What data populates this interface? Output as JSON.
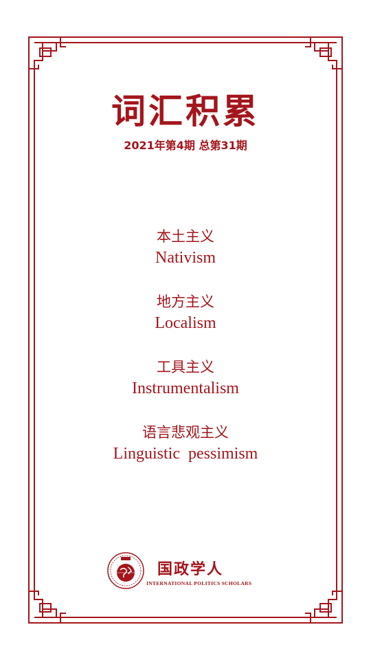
{
  "header": {
    "title": "词汇积累",
    "issue": "2021年第4期 总第31期"
  },
  "terms": [
    {
      "zh": "本土主义",
      "en": "Nativism"
    },
    {
      "zh": "地方主义",
      "en": "Localism"
    },
    {
      "zh": "工具主义",
      "en": "Instrumentalism"
    },
    {
      "zh": "语言悲观主义",
      "en": "Linguistic  pessimism"
    }
  ],
  "footer": {
    "brand_name": "国政学人",
    "brand_subtitle": "INTERNATIONAL POLITICS SCHOLARS",
    "logo_icon": "globe-seal-icon"
  },
  "colors": {
    "accent": "#a3161c",
    "background": "#ffffff"
  }
}
